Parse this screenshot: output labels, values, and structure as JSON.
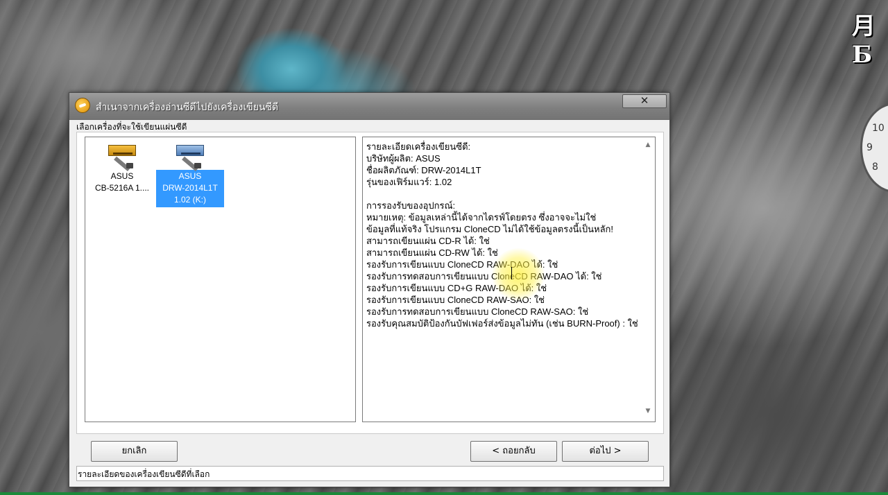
{
  "window": {
    "title": "สำเนาจากเครื่องอ่านซีดีไปยังเครื่องเขียนซีดี",
    "close_glyph": "✕"
  },
  "desktop": {
    "logo_text": "月Б",
    "clock_numbers": [
      "10",
      "9",
      "8"
    ]
  },
  "header": {
    "label": "เลือกเครื่องที่จะใช้เขียนแผ่นซีดี"
  },
  "devices": [
    {
      "name": "ASUS",
      "model": "CB-5216A 1....",
      "selected": false,
      "icon": "cd-drive-icon"
    },
    {
      "name": "ASUS",
      "model": "DRW-2014L1T",
      "extra": "1.02 (K:)",
      "selected": true,
      "icon": "cd-writer-icon"
    }
  ],
  "details": {
    "lines": [
      "รายละเอียดเครื่องเขียนซีดี:",
      "บริษัทผู้ผลิต: ASUS",
      "ชื่อผลิตภัณฑ์: DRW-2014L1T",
      "รุ่นของเฟิร์มแวร์: 1.02",
      "",
      "การรองรับของอุปกรณ์:",
      "หมายเหตุ: ข้อมูลเหล่านี้ได้จากไดรฟ์โดยตรง ซึ่งอาจจะไม่ใช่",
      "ข้อมูลที่แท้จริง โปรแกรม CloneCD ไม่ได้ใช้ข้อมูลตรงนี้เป็นหลัก!",
      "สามารถเขียนแผ่น CD-R ได้: ใช่",
      "สามารถเขียนแผ่น CD-RW ได้: ใช่",
      "รองรับการเขียนแบบ CloneCD RAW-DAO ได้: ใช่",
      "รองรับการทดสอบการเขียนแบบ CloneCD RAW-DAO ได้: ใช่",
      "รองรับการเขียนแบบ CD+G RAW-DAO ได้: ใช่",
      "รองรับการเขียนแบบ CloneCD RAW-SAO: ใช่",
      "รองรับการทดสอบการเขียนแบบ CloneCD RAW-SAO: ใช่",
      "รองรับคุณสมบัติป้องกันบัฟเฟอร์ส่งข้อมูลไม่ทัน (เช่น BURN-Proof) : ใช่"
    ],
    "scroll_up_glyph": "▲",
    "scroll_down_glyph": "▼"
  },
  "buttons": {
    "cancel": "ยกเลิก",
    "back": "< ถอยกลับ",
    "next": "ต่อไป >"
  },
  "status": {
    "text": "รายละเอียดของเครื่องเขียนซีดีที่เลือก"
  },
  "colors": {
    "selection": "#3399ff",
    "titlebar": "#8a8a8a"
  }
}
